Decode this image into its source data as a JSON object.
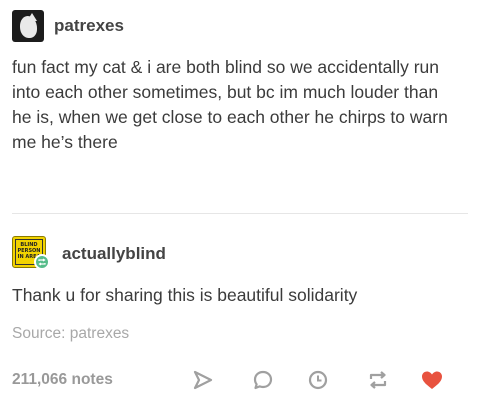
{
  "post_1": {
    "username": "patrexes",
    "text": "fun fact my cat & i are both blind so we accidentally run into each other sometimes, but bc im much louder than he is, when we get close to each other he chirps to warn me he’s there",
    "avatar_icon": "cat-avatar-icon"
  },
  "post_2": {
    "username": "actuallyblind",
    "text": "Thank u for sharing this is beautiful solidarity",
    "avatar_icon": "blind-person-sign-avatar-icon",
    "avatar_sign_text": "BLIND PERSON IN AREA",
    "reblog_badge_icon": "reblog-badge-icon"
  },
  "source": {
    "label": "Source:",
    "name": "patrexes"
  },
  "footer": {
    "notes": "211,066 notes",
    "actions": {
      "share": "share-icon",
      "reply": "reply-icon",
      "queue": "clock-icon",
      "reblog": "reblog-icon",
      "like": "heart-icon"
    },
    "like_color": "#e8523f",
    "icon_color": "#a0a0a0"
  },
  "colors": {
    "reblog_green": "#56bc8a",
    "sign_yellow": "#f2d300"
  }
}
